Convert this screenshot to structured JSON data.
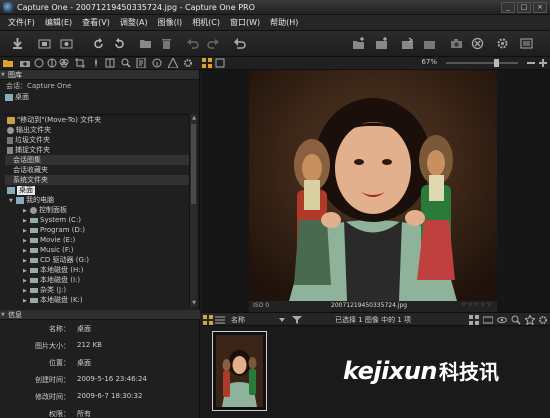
{
  "window": {
    "title": "Capture One - 20071219450335724.jpg - Capture One PRO",
    "controls": [
      "_",
      "□",
      "×"
    ]
  },
  "menu": [
    "文件(F)",
    "编辑(E)",
    "查看(V)",
    "调整(A)",
    "图像(I)",
    "相机(C)",
    "窗口(W)",
    "帮助(H)"
  ],
  "toolstrip": {
    "zoom": "67%"
  },
  "library": {
    "header": "图库",
    "session_label": "会话：Capture One",
    "desktop": "桌面",
    "items": [
      {
        "label": "\"移动到\"(Move-To) 文件夹",
        "icon": "folder-arrow-icon",
        "style": "normal"
      },
      {
        "label": "输出文件夹",
        "icon": "gear-icon",
        "style": "normal"
      },
      {
        "label": "垃圾文件夹",
        "icon": "trash-icon",
        "style": "normal"
      },
      {
        "label": "捕捉文件夹",
        "icon": "lock-icon",
        "style": "normal"
      },
      {
        "label": "会话图集",
        "icon": "",
        "style": "stripe"
      },
      {
        "label": "会话收藏夹",
        "icon": "",
        "style": "normal"
      },
      {
        "label": "系统文件夹",
        "icon": "",
        "style": "stripe"
      },
      {
        "label": "桌面",
        "icon": "desktop-icon",
        "style": "selected"
      },
      {
        "label": "我的电脑",
        "icon": "computer-icon",
        "style": "tree1"
      },
      {
        "label": "控制面板",
        "icon": "control-panel-icon",
        "style": "tree2"
      },
      {
        "label": "System (C:)",
        "icon": "drive-icon",
        "style": "tree2"
      },
      {
        "label": "Program (D:)",
        "icon": "drive-icon",
        "style": "tree2"
      },
      {
        "label": "Movie (E:)",
        "icon": "drive-icon",
        "style": "tree2"
      },
      {
        "label": "Music (F:)",
        "icon": "drive-icon",
        "style": "tree2"
      },
      {
        "label": "CD 驱动器 (G:)",
        "icon": "cd-drive-icon",
        "style": "tree2"
      },
      {
        "label": "本地磁盘 (H:)",
        "icon": "drive-icon",
        "style": "tree2"
      },
      {
        "label": "本地磁盘 (I:)",
        "icon": "drive-icon",
        "style": "tree2"
      },
      {
        "label": "杂类 (J:)",
        "icon": "drive-icon",
        "style": "tree2"
      },
      {
        "label": "本地磁盘 (K:)",
        "icon": "drive-icon",
        "style": "tree2"
      }
    ]
  },
  "info": {
    "header": "信息",
    "rows": [
      {
        "key": "名称：",
        "value": "桌面"
      },
      {
        "key": "图片大小：",
        "value": "212 KB"
      },
      {
        "key": "位置：",
        "value": "桌面"
      },
      {
        "key": "创建时间：",
        "value": "2009-5-16 23:46:24"
      },
      {
        "key": "修改时间：",
        "value": "2009-6-7 18:30:32"
      },
      {
        "key": "权限：",
        "value": "所有"
      }
    ]
  },
  "viewer": {
    "iso": "ISO 0",
    "filename": "20071219450335724.jpg",
    "stars": "☆☆☆☆☆"
  },
  "browser": {
    "sort_label": "名称",
    "selection": "已选择 1 图像 中的 1 项"
  },
  "watermark": {
    "latin": "kejixun",
    "cn": "科技讯"
  }
}
